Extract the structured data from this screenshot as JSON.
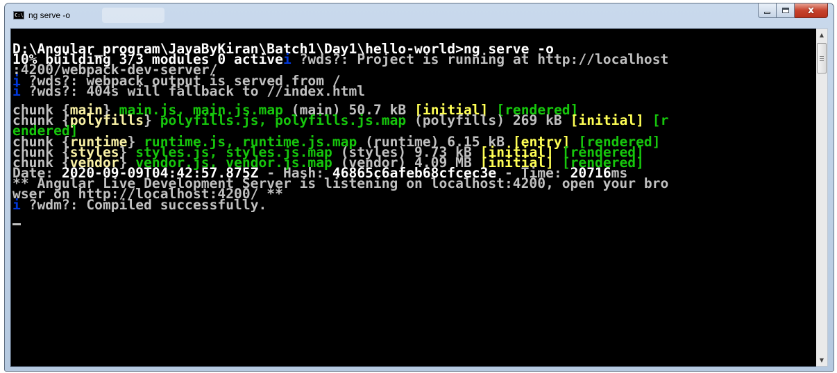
{
  "window": {
    "title": "ng serve -o",
    "icon": "console-icon",
    "icon_text": "C:\\",
    "controls": {
      "minimize": "minimize-icon",
      "maximize": "maximize-icon",
      "close": "close-icon",
      "close_glyph": "x"
    }
  },
  "console": {
    "l1": "D:\\Angular_program\\JavaByKiran\\Batch1\\Day1\\hello-world>ng serve -o",
    "l2a": "10% building 3/3 modules 0 active",
    "l2b": "i",
    "l2c": " ?wds?: Project is running at http://localhost",
    "l3": ":4200/webpack-dev-server/",
    "l4a": "i",
    "l4b": " ?wds?: webpack output is served from /",
    "l5a": "i",
    "l5b": " ?wds?: 404s will fallback to //index.html",
    "c1": {
      "a": "chunk {",
      "b": "main",
      "c": "} ",
      "d": "main.js, main.js.map",
      "e": " (main) 50.7 kB ",
      "f": "[initial]",
      "g": " ",
      "h": "[rendered]"
    },
    "c2": {
      "a": "chunk {",
      "b": "polyfills",
      "c": "} ",
      "d": "polyfills.js, polyfills.js.map",
      "e": " (polyfills) 269 kB ",
      "f": "[initial]",
      "g": " ",
      "h": "[r"
    },
    "c2w": "endered]",
    "c3": {
      "a": "chunk {",
      "b": "runtime",
      "c": "} ",
      "d": "runtime.js, runtime.js.map",
      "e": " (runtime) 6.15 kB ",
      "f": "[entry]",
      "g": " ",
      "h": "[rendered]"
    },
    "c4": {
      "a": "chunk {",
      "b": "styles",
      "c": "} ",
      "d": "styles.js, styles.js.map",
      "e": " (styles) 9.73 kB ",
      "f": "[initial]",
      "g": " ",
      "h": "[rendered]"
    },
    "c5": {
      "a": "chunk {",
      "b": "vendor",
      "c": "} ",
      "d": "vendor.js, vendor.js.map",
      "e": " (vendor) 4.09 MB ",
      "f": "[initial]",
      "g": " ",
      "h": "[rendered]"
    },
    "date": {
      "a": "Date: ",
      "b": "2020-09-09T04:42:57.875Z",
      "c": " - Hash: ",
      "d": "46865c6afeb68cfcec3e",
      "e": " - Time: ",
      "f": "20716",
      "g": "ms"
    },
    "live1": "** Angular Live Development Server is listening on localhost:4200, open your bro",
    "live2": "wser on http://localhost:4200/ **",
    "wdm_a": "i",
    "wdm_b": " ?wdm?: Compiled successfully."
  },
  "colors": {
    "background": "#000000",
    "default_text": "#c0c0c0",
    "bright_text": "#ffffff",
    "file_names": "#16c60c",
    "chunk_names": "#f9f1a5",
    "tags": "#ffff55",
    "info_icon": "#0037da"
  },
  "scrollbar": {
    "up": "scroll-up-icon",
    "down": "scroll-down-icon",
    "up_glyph": "▲",
    "down_glyph": "▼"
  }
}
